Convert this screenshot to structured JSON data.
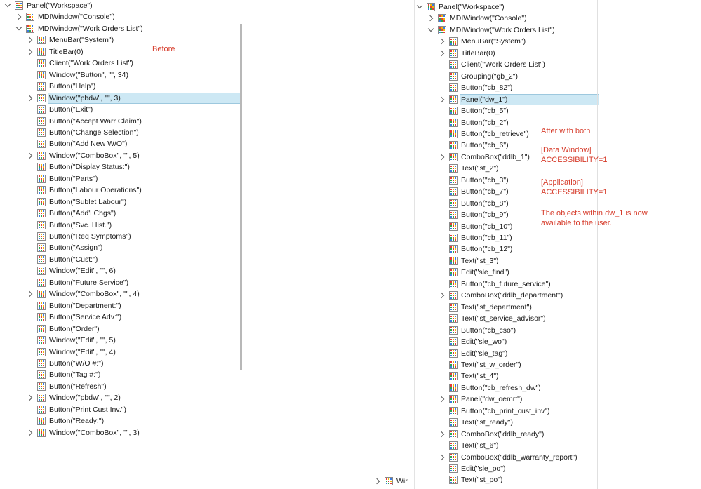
{
  "left": {
    "annotation": "Before",
    "nodes": [
      {
        "label": "Panel(\"Workspace\")",
        "indent": 0,
        "chevron": "down"
      },
      {
        "label": "MDIWindow(\"Console\")",
        "indent": 1,
        "chevron": "right"
      },
      {
        "label": "MDIWindow(\"Work Orders List\")",
        "indent": 1,
        "chevron": "down"
      },
      {
        "label": "MenuBar(\"System\")",
        "indent": 2,
        "chevron": "right"
      },
      {
        "label": "TitleBar(0)",
        "indent": 2,
        "chevron": "right"
      },
      {
        "label": "Client(\"Work Orders List\")",
        "indent": 2,
        "chevron": "none"
      },
      {
        "label": "Window(\"Button\", \"\", 34)",
        "indent": 2,
        "chevron": "none"
      },
      {
        "label": "Button(\"Help\")",
        "indent": 2,
        "chevron": "none"
      },
      {
        "label": "Window(\"pbdw\", \"\", 3)",
        "indent": 2,
        "chevron": "right",
        "selected": true
      },
      {
        "label": "Button(\"Exit\")",
        "indent": 2,
        "chevron": "none"
      },
      {
        "label": "Button(\"Accept Warr Claim\")",
        "indent": 2,
        "chevron": "none"
      },
      {
        "label": "Button(\"Change Selection\")",
        "indent": 2,
        "chevron": "none"
      },
      {
        "label": "Button(\"Add New W/O\")",
        "indent": 2,
        "chevron": "none"
      },
      {
        "label": "Window(\"ComboBox\", \"\", 5)",
        "indent": 2,
        "chevron": "right"
      },
      {
        "label": "Button(\"Display Status:\")",
        "indent": 2,
        "chevron": "none"
      },
      {
        "label": "Button(\"Parts\")",
        "indent": 2,
        "chevron": "none"
      },
      {
        "label": "Button(\"Labour Operations\")",
        "indent": 2,
        "chevron": "none"
      },
      {
        "label": "Button(\"Sublet Labour\")",
        "indent": 2,
        "chevron": "none"
      },
      {
        "label": "Button(\"Add'l Chgs\")",
        "indent": 2,
        "chevron": "none"
      },
      {
        "label": "Button(\"Svc. Hist.\")",
        "indent": 2,
        "chevron": "none"
      },
      {
        "label": "Button(\"Req Symptoms\")",
        "indent": 2,
        "chevron": "none"
      },
      {
        "label": "Button(\"Assign\")",
        "indent": 2,
        "chevron": "none"
      },
      {
        "label": "Button(\"Cust:\")",
        "indent": 2,
        "chevron": "none"
      },
      {
        "label": "Window(\"Edit\", \"\", 6)",
        "indent": 2,
        "chevron": "none"
      },
      {
        "label": "Button(\"Future Service\")",
        "indent": 2,
        "chevron": "none"
      },
      {
        "label": "Window(\"ComboBox\", \"\", 4)",
        "indent": 2,
        "chevron": "right"
      },
      {
        "label": "Button(\"Department:\")",
        "indent": 2,
        "chevron": "none"
      },
      {
        "label": "Button(\"Service Adv:\")",
        "indent": 2,
        "chevron": "none"
      },
      {
        "label": "Button(\"Order\")",
        "indent": 2,
        "chevron": "none"
      },
      {
        "label": "Window(\"Edit\", \"\", 5)",
        "indent": 2,
        "chevron": "none"
      },
      {
        "label": "Window(\"Edit\", \"\", 4)",
        "indent": 2,
        "chevron": "none"
      },
      {
        "label": "Button(\"W/O #:\")",
        "indent": 2,
        "chevron": "none"
      },
      {
        "label": "Button(\"Tag #:\")",
        "indent": 2,
        "chevron": "none"
      },
      {
        "label": "Button(\"Refresh\")",
        "indent": 2,
        "chevron": "none"
      },
      {
        "label": "Window(\"pbdw\", \"\", 2)",
        "indent": 2,
        "chevron": "right"
      },
      {
        "label": "Button(\"Print Cust Inv.\")",
        "indent": 2,
        "chevron": "none"
      },
      {
        "label": "Button(\"Ready:\")",
        "indent": 2,
        "chevron": "none"
      },
      {
        "label": "Window(\"ComboBox\", \"\", 3)",
        "indent": 2,
        "chevron": "right"
      }
    ]
  },
  "right": {
    "annotation_lines": [
      "After with both",
      "",
      "[Data Window]",
      "ACCESSIBILITY=1",
      "",
      "[Application]",
      "ACCESSIBILITY=1",
      "",
      "The objects within dw_1 is now",
      "available  to the user."
    ],
    "nodes": [
      {
        "label": "Panel(\"Workspace\")",
        "indent": 0,
        "chevron": "down"
      },
      {
        "label": "MDIWindow(\"Console\")",
        "indent": 1,
        "chevron": "right"
      },
      {
        "label": "MDIWindow(\"Work Orders List\")",
        "indent": 1,
        "chevron": "down"
      },
      {
        "label": "MenuBar(\"System\")",
        "indent": 2,
        "chevron": "right"
      },
      {
        "label": "TitleBar(0)",
        "indent": 2,
        "chevron": "right"
      },
      {
        "label": "Client(\"Work Orders List\")",
        "indent": 2,
        "chevron": "none"
      },
      {
        "label": "Grouping(\"gb_2\")",
        "indent": 2,
        "chevron": "none"
      },
      {
        "label": "Button(\"cb_82\")",
        "indent": 2,
        "chevron": "none"
      },
      {
        "label": "Panel(\"dw_1\")",
        "indent": 2,
        "chevron": "right",
        "selected": true
      },
      {
        "label": "Button(\"cb_5\")",
        "indent": 2,
        "chevron": "none"
      },
      {
        "label": "Button(\"cb_2\")",
        "indent": 2,
        "chevron": "none"
      },
      {
        "label": "Button(\"cb_retrieve\")",
        "indent": 2,
        "chevron": "none"
      },
      {
        "label": "Button(\"cb_6\")",
        "indent": 2,
        "chevron": "none"
      },
      {
        "label": "ComboBox(\"ddlb_1\")",
        "indent": 2,
        "chevron": "right"
      },
      {
        "label": "Text(\"st_2\")",
        "indent": 2,
        "chevron": "none"
      },
      {
        "label": "Button(\"cb_3\")",
        "indent": 2,
        "chevron": "none"
      },
      {
        "label": "Button(\"cb_7\")",
        "indent": 2,
        "chevron": "none"
      },
      {
        "label": "Button(\"cb_8\")",
        "indent": 2,
        "chevron": "none"
      },
      {
        "label": "Button(\"cb_9\")",
        "indent": 2,
        "chevron": "none"
      },
      {
        "label": "Button(\"cb_10\")",
        "indent": 2,
        "chevron": "none"
      },
      {
        "label": "Button(\"cb_11\")",
        "indent": 2,
        "chevron": "none"
      },
      {
        "label": "Button(\"cb_12\")",
        "indent": 2,
        "chevron": "none"
      },
      {
        "label": "Text(\"st_3\")",
        "indent": 2,
        "chevron": "none"
      },
      {
        "label": "Edit(\"sle_find\")",
        "indent": 2,
        "chevron": "none"
      },
      {
        "label": "Button(\"cb_future_service\")",
        "indent": 2,
        "chevron": "none"
      },
      {
        "label": "ComboBox(\"ddlb_department\")",
        "indent": 2,
        "chevron": "right"
      },
      {
        "label": "Text(\"st_department\")",
        "indent": 2,
        "chevron": "none"
      },
      {
        "label": "Text(\"st_service_advisor\")",
        "indent": 2,
        "chevron": "none"
      },
      {
        "label": "Button(\"cb_cso\")",
        "indent": 2,
        "chevron": "none"
      },
      {
        "label": "Edit(\"sle_wo\")",
        "indent": 2,
        "chevron": "none"
      },
      {
        "label": "Edit(\"sle_tag\")",
        "indent": 2,
        "chevron": "none"
      },
      {
        "label": "Text(\"st_w_order\")",
        "indent": 2,
        "chevron": "none"
      },
      {
        "label": "Text(\"st_4\")",
        "indent": 2,
        "chevron": "none"
      },
      {
        "label": "Button(\"cb_refresh_dw\")",
        "indent": 2,
        "chevron": "none"
      },
      {
        "label": "Panel(\"dw_oemrt\")",
        "indent": 2,
        "chevron": "right"
      },
      {
        "label": "Button(\"cb_print_cust_inv\")",
        "indent": 2,
        "chevron": "none"
      },
      {
        "label": "Text(\"st_ready\")",
        "indent": 2,
        "chevron": "none"
      },
      {
        "label": "ComboBox(\"ddlb_ready\")",
        "indent": 2,
        "chevron": "right"
      },
      {
        "label": "Text(\"st_6\")",
        "indent": 2,
        "chevron": "none"
      },
      {
        "label": "ComboBox(\"ddlb_warranty_report\")",
        "indent": 2,
        "chevron": "right"
      },
      {
        "label": "Edit(\"sle_po\")",
        "indent": 2,
        "chevron": "none"
      },
      {
        "label": "Text(\"st_po\")",
        "indent": 2,
        "chevron": "none"
      }
    ]
  },
  "bottom_stub": {
    "label": "Wir",
    "chevron": "right"
  },
  "colors": {
    "annotation": "#d63b2a",
    "selection": "#cde8f4",
    "selection_border": "#9dc8de"
  }
}
